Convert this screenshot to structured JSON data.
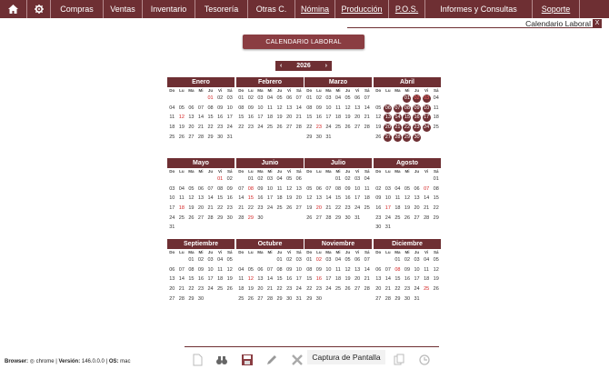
{
  "nav": {
    "items": [
      {
        "label": "Compras",
        "width": 58
      },
      {
        "label": "Ventas",
        "width": 43
      },
      {
        "label": "Inventario",
        "width": 58
      },
      {
        "label": "Tesorería",
        "width": 58
      },
      {
        "label": "Otras C.",
        "width": 52
      },
      {
        "label": "Nómina",
        "width": 44,
        "underline": true
      },
      {
        "label": "Producción",
        "width": 59,
        "underline": true
      },
      {
        "label": "P.O.S.",
        "width": 40,
        "underline": true
      },
      {
        "label": "Informes y Consultas",
        "width": 118
      },
      {
        "label": "Soporte",
        "width": 52,
        "underline": true
      }
    ]
  },
  "header": {
    "subtitle": "Calendario Laboral",
    "close": "X"
  },
  "title_button": "CALENDARIO LABORAL",
  "year": {
    "value": "2026",
    "prev": "‹",
    "next": "›"
  },
  "dow": [
    "Do",
    "Lu",
    "Ma",
    "Mi",
    "Ju",
    "Vi",
    "Sá"
  ],
  "months": [
    {
      "name": "Enero",
      "start": 4,
      "days": 31,
      "red": [
        1,
        12
      ],
      "sel": []
    },
    {
      "name": "Febrero",
      "start": 0,
      "days": 28,
      "red": [],
      "sel": []
    },
    {
      "name": "Marzo",
      "start": 0,
      "days": 31,
      "red": [
        23
      ],
      "sel": []
    },
    {
      "name": "Abril",
      "start": 3,
      "days": 30,
      "red": [
        2,
        3
      ],
      "sel": [
        1,
        2,
        3,
        6,
        7,
        8,
        9,
        10,
        13,
        14,
        15,
        16,
        17,
        20,
        21,
        22,
        23,
        24,
        27,
        28,
        29,
        30
      ]
    },
    {
      "name": "Mayo",
      "start": 5,
      "days": 31,
      "red": [
        1,
        18
      ],
      "sel": []
    },
    {
      "name": "Junio",
      "start": 1,
      "days": 30,
      "red": [
        8,
        15,
        29
      ],
      "sel": []
    },
    {
      "name": "Julio",
      "start": 3,
      "days": 31,
      "red": [
        20
      ],
      "sel": []
    },
    {
      "name": "Agosto",
      "start": 6,
      "days": 31,
      "red": [
        7,
        17
      ],
      "sel": []
    },
    {
      "name": "Septiembre",
      "start": 2,
      "days": 30,
      "red": [],
      "sel": []
    },
    {
      "name": "Octubre",
      "start": 4,
      "days": 31,
      "red": [
        12
      ],
      "sel": []
    },
    {
      "name": "Noviembre",
      "start": 0,
      "days": 30,
      "red": [
        2,
        16
      ],
      "sel": []
    },
    {
      "name": "Diciembre",
      "start": 2,
      "days": 31,
      "red": [
        8,
        25
      ],
      "sel": []
    }
  ],
  "footer": {
    "browser_label": "Browser:",
    "browser_value": "chrome",
    "version_label": "Versión:",
    "version_value": "146.0.0.0",
    "os_label": "OS:",
    "os_value": "mac",
    "capture": "Captura de Pantalla"
  },
  "colors": {
    "brand": "#6e2f33",
    "holiday": "#d32020"
  }
}
